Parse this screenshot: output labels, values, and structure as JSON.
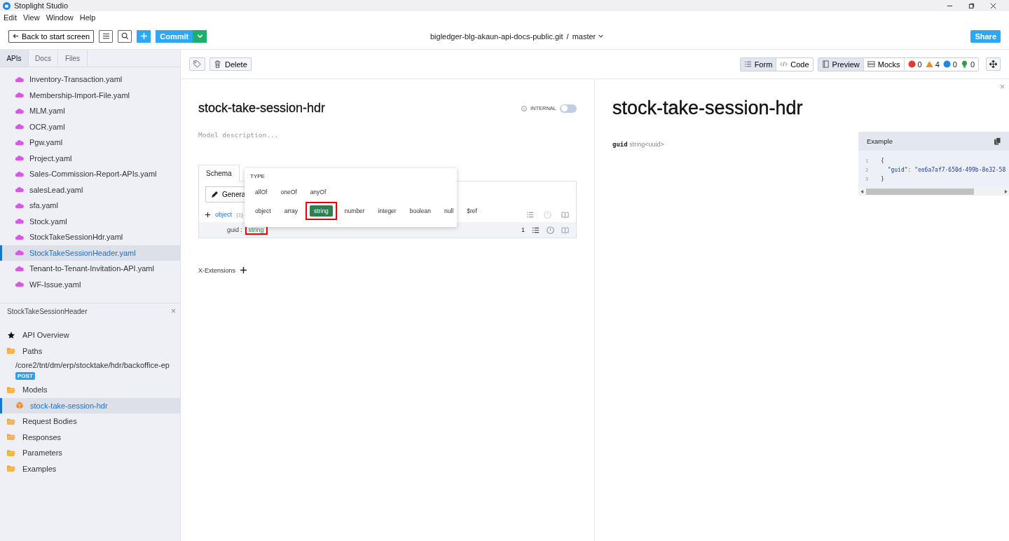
{
  "window": {
    "title": "Stoplight Studio"
  },
  "menu": [
    "Edit",
    "View",
    "Window",
    "Help"
  ],
  "toolbar": {
    "back_label": "Back to start screen",
    "commit_label": "Commit",
    "repo": "bigledger-blg-akaun-api-docs-public.git",
    "separator": "/",
    "branch": "master",
    "share_label": "Share"
  },
  "sidebar": {
    "tabs": [
      {
        "label": "APIs",
        "selected": true
      },
      {
        "label": "Docs",
        "selected": false
      },
      {
        "label": "Files",
        "selected": false
      }
    ],
    "files": [
      {
        "name": "Inventory-Transaction.yaml",
        "selected": false
      },
      {
        "name": "Membership-Import-File.yaml",
        "selected": false
      },
      {
        "name": "MLM.yaml",
        "selected": false
      },
      {
        "name": "OCR.yaml",
        "selected": false
      },
      {
        "name": "Pgw.yaml",
        "selected": false
      },
      {
        "name": "Project.yaml",
        "selected": false
      },
      {
        "name": "Sales-Commission-Report-APIs.yaml",
        "selected": false
      },
      {
        "name": "salesLead.yaml",
        "selected": false
      },
      {
        "name": "sfa.yaml",
        "selected": false
      },
      {
        "name": "Stock.yaml",
        "selected": false
      },
      {
        "name": "StockTakeSessionHdr.yaml",
        "selected": false
      },
      {
        "name": "StockTakeSessionHeader.yaml",
        "selected": true
      },
      {
        "name": "Tenant-to-Tenant-Invitation-API.yaml",
        "selected": false
      },
      {
        "name": "WF-Issue.yaml",
        "selected": false
      }
    ],
    "outline": {
      "title": "StockTakeSessionHeader",
      "close": "×",
      "items": [
        {
          "kind": "overview",
          "label": "API Overview",
          "selected": false
        },
        {
          "kind": "folder",
          "label": "Paths",
          "selected": false,
          "children": [
            {
              "kind": "path",
              "label": "/core2/tnt/dm/erp/stocktake/hdr/backoffice-ep",
              "method": "POST",
              "selected": false
            }
          ]
        },
        {
          "kind": "folder",
          "label": "Models",
          "selected": false,
          "children": [
            {
              "kind": "model",
              "label": "stock-take-session-hdr",
              "selected": true
            }
          ]
        },
        {
          "kind": "folder",
          "label": "Request Bodies",
          "selected": false
        },
        {
          "kind": "folder",
          "label": "Responses",
          "selected": false
        },
        {
          "kind": "folder",
          "label": "Parameters",
          "selected": false
        },
        {
          "kind": "folder",
          "label": "Examples",
          "selected": false
        }
      ]
    }
  },
  "editor_toolbar": {
    "delete_label": "Delete",
    "mode_toggle": [
      {
        "label": "Form",
        "kind": "form",
        "selected": true
      },
      {
        "label": "Code",
        "kind": "code",
        "selected": false
      }
    ],
    "panel_toggle": [
      {
        "label": "Preview",
        "kind": "preview",
        "selected": true
      },
      {
        "label": "Mocks",
        "kind": "mocks",
        "selected": false
      }
    ],
    "diagnostics": [
      {
        "kind": "error",
        "count": "0"
      },
      {
        "kind": "warning",
        "count": "4"
      },
      {
        "kind": "info",
        "count": "0"
      },
      {
        "kind": "hint",
        "count": "0"
      }
    ]
  },
  "editor": {
    "title": "stock-take-session-hdr",
    "internal_label": "INTERNAL",
    "internal_on": false,
    "description_placeholder": "Model description...",
    "schema_tab": "Schema",
    "generate_label": "Genera",
    "root": {
      "type": "object",
      "count": "{1}"
    },
    "properties": [
      {
        "name": "guid",
        "separator": ":",
        "type": "string",
        "highlighted": true,
        "validations": "1"
      }
    ],
    "type_popover": {
      "title": "TYPE",
      "combiners": [
        "allOf",
        "oneOf",
        "anyOf"
      ],
      "types": [
        {
          "label": "object",
          "selected": false,
          "highlighted": false
        },
        {
          "label": "array",
          "selected": false,
          "highlighted": false
        },
        {
          "label": "string",
          "selected": true,
          "highlighted": true
        },
        {
          "label": "number",
          "selected": false,
          "highlighted": false
        },
        {
          "label": "integer",
          "selected": false,
          "highlighted": false
        },
        {
          "label": "boolean",
          "selected": false,
          "highlighted": false
        },
        {
          "label": "null",
          "selected": false,
          "highlighted": false
        },
        {
          "label": "$ref",
          "selected": false,
          "highlighted": false
        }
      ]
    },
    "extensions_label": "X-Extensions"
  },
  "preview": {
    "close": "×",
    "title": "stock-take-session-hdr",
    "properties": [
      {
        "name": "guid",
        "type": "string<uuid>"
      }
    ],
    "example": {
      "title": "Example",
      "lines": [
        {
          "num": "1",
          "parts": [
            {
              "kind": "punct",
              "text": "{"
            }
          ]
        },
        {
          "num": "2",
          "parts": [
            {
              "kind": "key",
              "text": "  \"guid\""
            },
            {
              "kind": "colon",
              "text": ": "
            },
            {
              "kind": "string",
              "text": "\"ee6a7af7-650d-499b-8e32-58"
            }
          ]
        },
        {
          "num": "3",
          "parts": [
            {
              "kind": "punct",
              "text": "}"
            }
          ]
        }
      ]
    }
  }
}
